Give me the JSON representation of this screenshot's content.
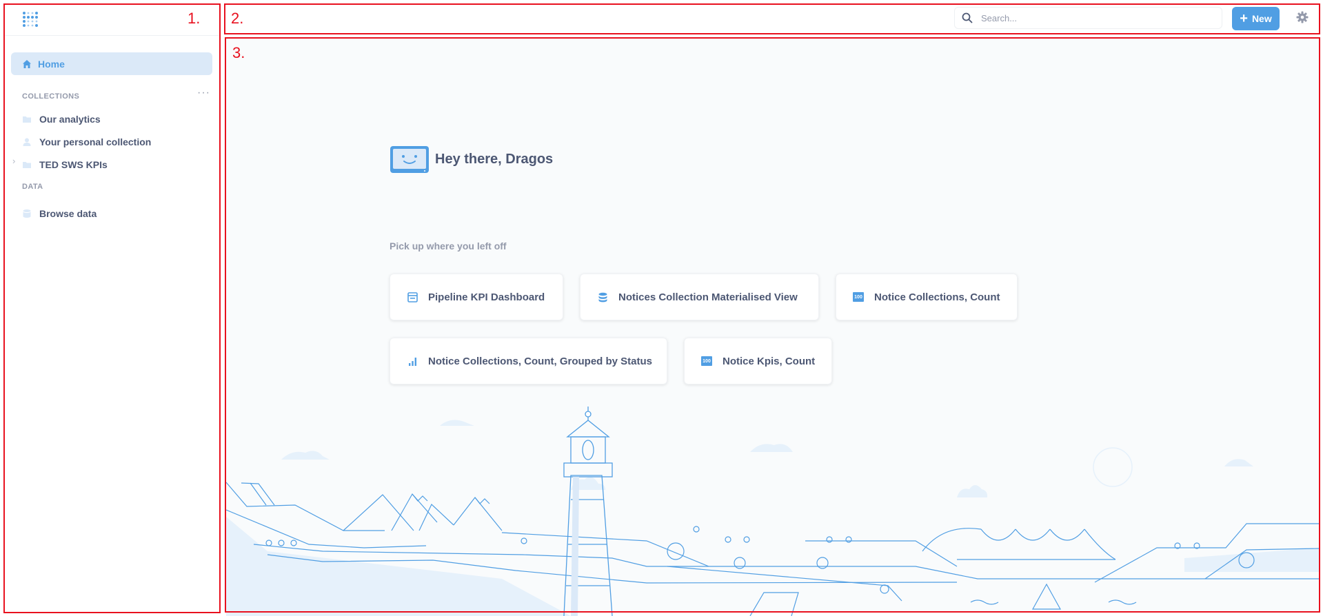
{
  "annotations": [
    "1.",
    "2.",
    "3."
  ],
  "sidebar": {
    "home_label": "Home",
    "collections_title": "COLLECTIONS",
    "collections_more": "···",
    "collections": [
      {
        "label": "Our analytics",
        "icon": "folder-icon"
      },
      {
        "label": "Your personal collection",
        "icon": "person-icon"
      },
      {
        "label": "TED SWS KPIs",
        "icon": "folder-icon",
        "expandable": true
      }
    ],
    "data_title": "DATA",
    "browse_data_label": "Browse data"
  },
  "topbar": {
    "search_placeholder": "Search...",
    "new_label": "New"
  },
  "main": {
    "greeting": "Hey there, Dragos",
    "subtitle": "Pick up where you left off",
    "recent_items": [
      {
        "label": "Pipeline KPI Dashboard",
        "icon": "dashboard-icon"
      },
      {
        "label": "Notices Collection Materialised View",
        "icon": "database-icon"
      },
      {
        "label": "Notice Collections, Count",
        "icon": "number-icon",
        "badge": "100"
      },
      {
        "label": "Notice Collections, Count, Grouped by Status",
        "icon": "bar-chart-icon"
      },
      {
        "label": "Notice Kpis, Count",
        "icon": "number-icon",
        "badge": "100"
      }
    ]
  },
  "colors": {
    "brand": "#509ee3",
    "text": "#4c5773",
    "muted": "#949aab",
    "annotation": "#e8101e",
    "main_bg": "#f9fbfc"
  }
}
